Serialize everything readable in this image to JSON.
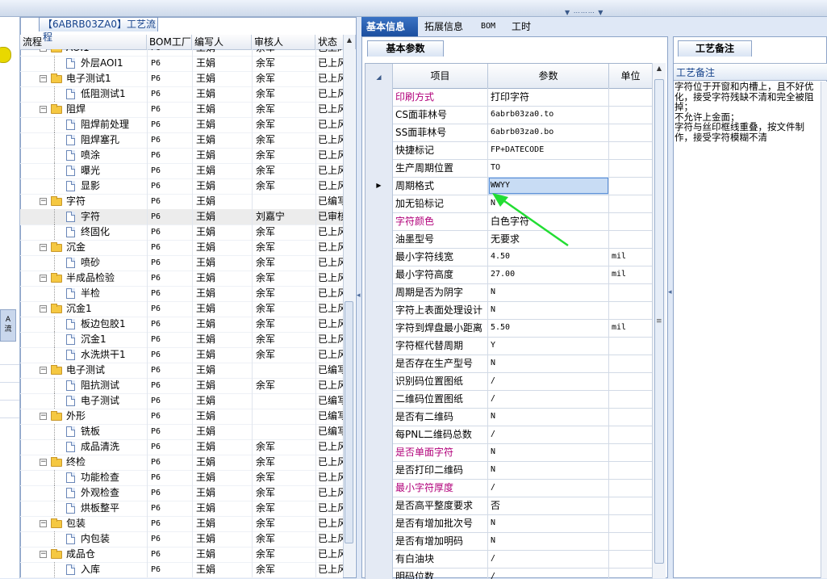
{
  "tree": {
    "tab_title": "【6ABRB03ZA0】工艺流程",
    "columns": [
      "流程",
      "BOM工厂",
      "编写人",
      "审核人",
      "状态"
    ],
    "rows": [
      {
        "level": 0,
        "type": "folder",
        "name": "AOI1",
        "factory": "P6",
        "writer": "王娟",
        "reviewer": "余军",
        "status": "已上风"
      },
      {
        "level": 1,
        "type": "doc",
        "name": "外层AOI1",
        "factory": "P6",
        "writer": "王娟",
        "reviewer": "余军",
        "status": "已上风"
      },
      {
        "level": 0,
        "type": "folder",
        "name": "电子测试1",
        "factory": "P6",
        "writer": "王娟",
        "reviewer": "余军",
        "status": "已上风"
      },
      {
        "level": 1,
        "type": "doc",
        "name": "低阻测试1",
        "factory": "P6",
        "writer": "王娟",
        "reviewer": "余军",
        "status": "已上风"
      },
      {
        "level": 0,
        "type": "folder",
        "name": "阻焊",
        "factory": "P6",
        "writer": "王娟",
        "reviewer": "余军",
        "status": "已上风"
      },
      {
        "level": 1,
        "type": "doc",
        "name": "阻焊前处理",
        "factory": "P6",
        "writer": "王娟",
        "reviewer": "余军",
        "status": "已上风"
      },
      {
        "level": 1,
        "type": "doc",
        "name": "阻焊塞孔",
        "factory": "P6",
        "writer": "王娟",
        "reviewer": "余军",
        "status": "已上风"
      },
      {
        "level": 1,
        "type": "doc",
        "name": "喷涂",
        "factory": "P6",
        "writer": "王娟",
        "reviewer": "余军",
        "status": "已上风"
      },
      {
        "level": 1,
        "type": "doc",
        "name": "曝光",
        "factory": "P6",
        "writer": "王娟",
        "reviewer": "余军",
        "status": "已上风"
      },
      {
        "level": 1,
        "type": "doc",
        "name": "显影",
        "factory": "P6",
        "writer": "王娟",
        "reviewer": "余军",
        "status": "已上风"
      },
      {
        "level": 0,
        "type": "folder",
        "name": "字符",
        "factory": "P6",
        "writer": "王娟",
        "reviewer": "",
        "status": "已编写"
      },
      {
        "level": 1,
        "type": "doc",
        "name": "字符",
        "factory": "P6",
        "writer": "王娟",
        "reviewer": "刘嘉宁",
        "status": "已审核",
        "selected": true
      },
      {
        "level": 1,
        "type": "doc",
        "name": "终固化",
        "factory": "P6",
        "writer": "王娟",
        "reviewer": "余军",
        "status": "已上风"
      },
      {
        "level": 0,
        "type": "folder",
        "name": "沉金",
        "factory": "P6",
        "writer": "王娟",
        "reviewer": "余军",
        "status": "已上风"
      },
      {
        "level": 1,
        "type": "doc",
        "name": "喷砂",
        "factory": "P6",
        "writer": "王娟",
        "reviewer": "余军",
        "status": "已上风"
      },
      {
        "level": 0,
        "type": "folder",
        "name": "半成品检验",
        "factory": "P6",
        "writer": "王娟",
        "reviewer": "余军",
        "status": "已上风"
      },
      {
        "level": 1,
        "type": "doc",
        "name": "半检",
        "factory": "P6",
        "writer": "王娟",
        "reviewer": "余军",
        "status": "已上风"
      },
      {
        "level": 0,
        "type": "folder",
        "name": "沉金1",
        "factory": "P6",
        "writer": "王娟",
        "reviewer": "余军",
        "status": "已上风"
      },
      {
        "level": 1,
        "type": "doc",
        "name": "板边包胶1",
        "factory": "P6",
        "writer": "王娟",
        "reviewer": "余军",
        "status": "已上风"
      },
      {
        "level": 1,
        "type": "doc",
        "name": "沉金1",
        "factory": "P6",
        "writer": "王娟",
        "reviewer": "余军",
        "status": "已上风"
      },
      {
        "level": 1,
        "type": "doc",
        "name": "水洗烘干1",
        "factory": "P6",
        "writer": "王娟",
        "reviewer": "余军",
        "status": "已上风"
      },
      {
        "level": 0,
        "type": "folder",
        "name": "电子测试",
        "factory": "P6",
        "writer": "王娟",
        "reviewer": "",
        "status": "已编写"
      },
      {
        "level": 1,
        "type": "doc",
        "name": "阻抗测试",
        "factory": "P6",
        "writer": "王娟",
        "reviewer": "余军",
        "status": "已上风"
      },
      {
        "level": 1,
        "type": "doc",
        "name": "电子测试",
        "factory": "P6",
        "writer": "王娟",
        "reviewer": "",
        "status": "已编写"
      },
      {
        "level": 0,
        "type": "folder",
        "name": "外形",
        "factory": "P6",
        "writer": "王娟",
        "reviewer": "",
        "status": "已编写"
      },
      {
        "level": 1,
        "type": "doc",
        "name": "铣板",
        "factory": "P6",
        "writer": "王娟",
        "reviewer": "",
        "status": "已编写"
      },
      {
        "level": 1,
        "type": "doc",
        "name": "成品清洗",
        "factory": "P6",
        "writer": "王娟",
        "reviewer": "余军",
        "status": "已上风"
      },
      {
        "level": 0,
        "type": "folder",
        "name": "终检",
        "factory": "P6",
        "writer": "王娟",
        "reviewer": "余军",
        "status": "已上风"
      },
      {
        "level": 1,
        "type": "doc",
        "name": "功能检查",
        "factory": "P6",
        "writer": "王娟",
        "reviewer": "余军",
        "status": "已上风"
      },
      {
        "level": 1,
        "type": "doc",
        "name": "外观检查",
        "factory": "P6",
        "writer": "王娟",
        "reviewer": "余军",
        "status": "已上风"
      },
      {
        "level": 1,
        "type": "doc",
        "name": "烘板整平",
        "factory": "P6",
        "writer": "王娟",
        "reviewer": "余军",
        "status": "已上风"
      },
      {
        "level": 0,
        "type": "folder",
        "name": "包装",
        "factory": "P6",
        "writer": "王娟",
        "reviewer": "余军",
        "status": "已上风"
      },
      {
        "level": 1,
        "type": "doc",
        "name": "内包装",
        "factory": "P6",
        "writer": "王娟",
        "reviewer": "余军",
        "status": "已上风"
      },
      {
        "level": 0,
        "type": "folder",
        "name": "成品仓",
        "factory": "P6",
        "writer": "王娟",
        "reviewer": "余军",
        "status": "已上风"
      },
      {
        "level": 1,
        "type": "doc",
        "name": "入库",
        "factory": "P6",
        "writer": "王娟",
        "reviewer": "余军",
        "status": "已上风"
      }
    ]
  },
  "tabs": [
    "基本信息",
    "拓展信息",
    "BOM",
    "工时"
  ],
  "params": {
    "subtab": "基本参数",
    "columns": [
      "项目",
      "参数",
      "单位"
    ],
    "rows": [
      {
        "item": "印刷方式",
        "value": "打印字符",
        "unit": "",
        "highlight": true
      },
      {
        "item": "CS面菲林号",
        "value": "6abrb03za0.to",
        "unit": ""
      },
      {
        "item": "SS面菲林号",
        "value": "6abrb03za0.bo",
        "unit": ""
      },
      {
        "item": "快捷标记",
        "value": "FP+DATECODE",
        "unit": ""
      },
      {
        "item": "生产周期位置",
        "value": "TO",
        "unit": ""
      },
      {
        "item": "周期格式",
        "value": "WWYY",
        "unit": "",
        "current": true
      },
      {
        "item": "加无铅标记",
        "value": "N",
        "unit": ""
      },
      {
        "item": "字符颜色",
        "value": "白色字符",
        "unit": "",
        "highlight": true
      },
      {
        "item": "油墨型号",
        "value": "无要求",
        "unit": ""
      },
      {
        "item": "最小字符线宽",
        "value": "4.50",
        "unit": "mil"
      },
      {
        "item": "最小字符高度",
        "value": "27.00",
        "unit": "mil"
      },
      {
        "item": "周期是否为阴字",
        "value": "N",
        "unit": ""
      },
      {
        "item": "字符上表面处理设计",
        "value": "N",
        "unit": ""
      },
      {
        "item": "字符到焊盘最小距离",
        "value": "5.50",
        "unit": "mil"
      },
      {
        "item": "字符框代替周期",
        "value": "Y",
        "unit": ""
      },
      {
        "item": "是否存在生产型号",
        "value": "N",
        "unit": ""
      },
      {
        "item": "识别码位置图纸",
        "value": "/",
        "unit": ""
      },
      {
        "item": "二维码位置图纸",
        "value": "/",
        "unit": ""
      },
      {
        "item": "是否有二维码",
        "value": "N",
        "unit": ""
      },
      {
        "item": "每PNL二维码总数",
        "value": "/",
        "unit": ""
      },
      {
        "item": "是否单面字符",
        "value": "N",
        "unit": "",
        "highlight": true
      },
      {
        "item": "是否打印二维码",
        "value": "N",
        "unit": ""
      },
      {
        "item": "最小字符厚度",
        "value": "/",
        "unit": "",
        "highlight": true
      },
      {
        "item": "是否高平整度要求",
        "value": "否",
        "unit": ""
      },
      {
        "item": "是否有增加批次号",
        "value": "N",
        "unit": ""
      },
      {
        "item": "是否有增加明码",
        "value": "N",
        "unit": ""
      },
      {
        "item": "有白油块",
        "value": "/",
        "unit": ""
      },
      {
        "item": "明码位数",
        "value": "/",
        "unit": ""
      }
    ]
  },
  "notes": {
    "tab": "工艺备注",
    "header": "工艺备注",
    "text": "字符位于开窗和内槽上，且不好优化，接受字符残缺不清和完全被阻掉；\n不允许上金面；\n字符与丝印框线重叠，按文件制作，接受字符模糊不清"
  },
  "colors": {
    "accent": "#1c4f9f",
    "highlight_text": "#b1007a",
    "arrow": "#22dd33"
  },
  "left_strip": {
    "tab_text": "A 流"
  }
}
